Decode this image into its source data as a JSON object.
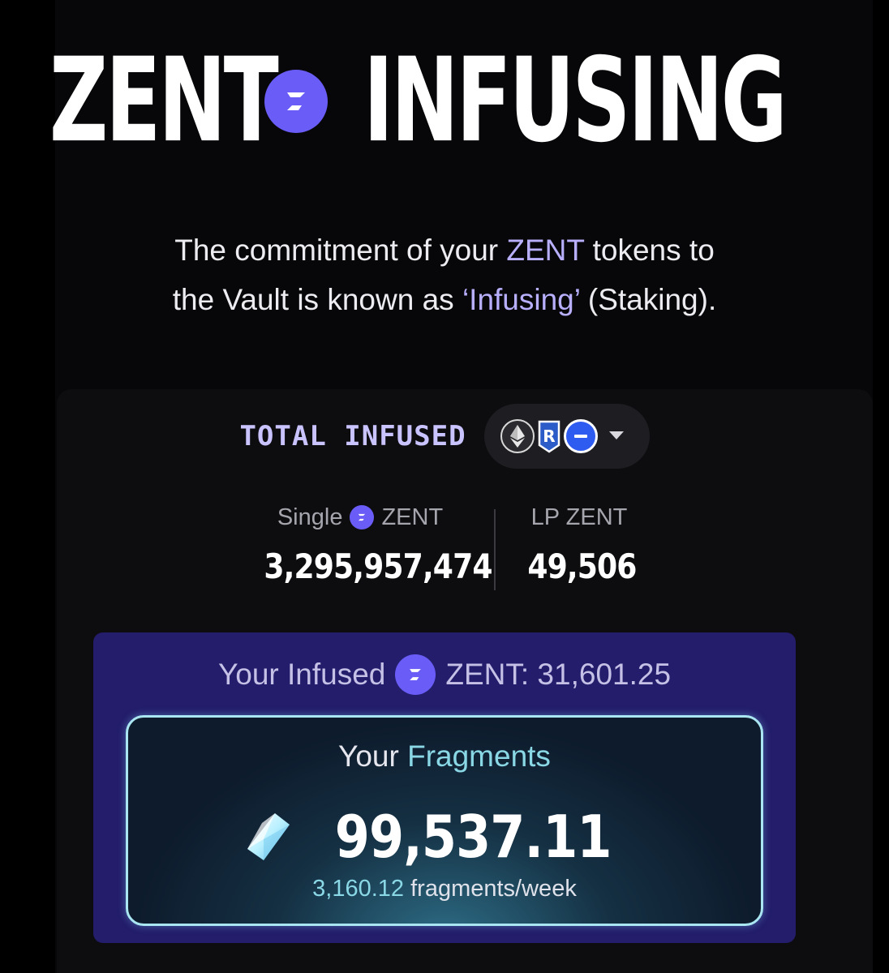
{
  "hero": {
    "word_left": "ZENT",
    "word_right": "INFUSING",
    "logo_icon": "zent-logo-icon"
  },
  "subtitle": {
    "line1_pre": "The commitment of your ",
    "line1_accent": "ZENT",
    "line1_post": " tokens to",
    "line2_pre": "the Vault is known as ",
    "line2_accent": "‘Infusing’",
    "line2_post": " (Staking)."
  },
  "total": {
    "label": "TOTAL INFUSED",
    "chains": [
      "ethereum-icon",
      "arbitrum-icon",
      "base-icon"
    ],
    "dropdown_icon": "chevron-down-icon"
  },
  "stats": {
    "single_label_pre": "Single",
    "single_label_post": "ZENT",
    "single_value": "3,295,957,474",
    "lp_label": "LP ZENT",
    "lp_value": "49,506"
  },
  "infused": {
    "prefix": "Your Infused",
    "suffix": "ZENT: 31,601.25"
  },
  "fragments": {
    "title_pre": "Your ",
    "title_accent": "Fragments",
    "value": "99,537.11",
    "rate_value": "3,160.12",
    "rate_unit": " fragments/week"
  },
  "colors": {
    "accent_purple": "#b8b0ff",
    "logo_purple": "#6a5cf6",
    "card_purple": "#231d6b",
    "fragment_cyan": "#8ad8e6"
  }
}
